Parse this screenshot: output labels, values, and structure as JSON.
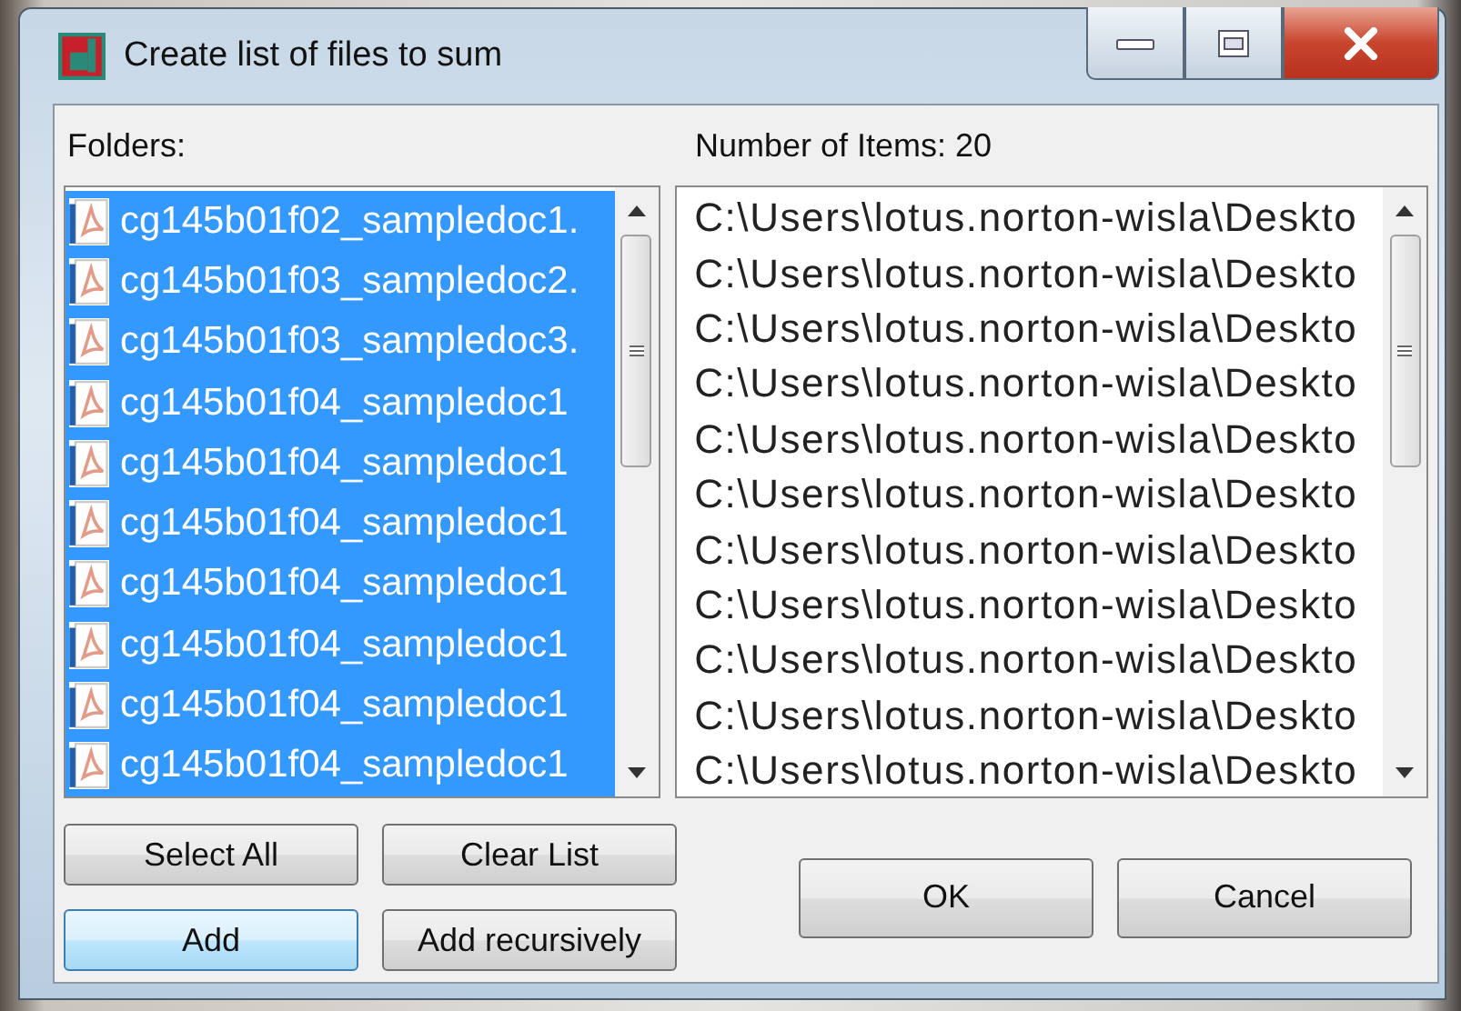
{
  "window": {
    "title": "Create list of files to sum"
  },
  "folders": {
    "label": "Folders:",
    "items": [
      {
        "name": "cg145b01f02_sampledoc1.",
        "selected": true
      },
      {
        "name": "cg145b01f03_sampledoc2.",
        "selected": true
      },
      {
        "name": "cg145b01f03_sampledoc3.",
        "selected": true
      },
      {
        "name": "cg145b01f04_sampledoc1",
        "selected": true
      },
      {
        "name": "cg145b01f04_sampledoc1",
        "selected": true
      },
      {
        "name": "cg145b01f04_sampledoc1",
        "selected": true
      },
      {
        "name": "cg145b01f04_sampledoc1",
        "selected": true
      },
      {
        "name": "cg145b01f04_sampledoc1",
        "selected": true
      },
      {
        "name": "cg145b01f04_sampledoc1",
        "selected": true
      },
      {
        "name": "cg145b01f04_sampledoc1",
        "selected": true
      }
    ]
  },
  "files": {
    "label": "Number of Items: 20",
    "items": [
      "C:\\Users\\lotus.norton-wisla\\Deskto",
      "C:\\Users\\lotus.norton-wisla\\Deskto",
      "C:\\Users\\lotus.norton-wisla\\Deskto",
      "C:\\Users\\lotus.norton-wisla\\Deskto",
      "C:\\Users\\lotus.norton-wisla\\Deskto",
      "C:\\Users\\lotus.norton-wisla\\Deskto",
      "C:\\Users\\lotus.norton-wisla\\Deskto",
      "C:\\Users\\lotus.norton-wisla\\Deskto",
      "C:\\Users\\lotus.norton-wisla\\Deskto",
      "C:\\Users\\lotus.norton-wisla\\Deskto",
      "C:\\Users\\lotus.norton-wisla\\Deskto"
    ]
  },
  "list_buttons": [
    {
      "label": "Select All",
      "focused": false
    },
    {
      "label": "Clear List",
      "focused": false
    },
    {
      "label": "Add",
      "focused": true
    },
    {
      "label": "Add recursively",
      "focused": false
    }
  ],
  "dialog_buttons": [
    {
      "label": "OK"
    },
    {
      "label": "Cancel"
    }
  ]
}
